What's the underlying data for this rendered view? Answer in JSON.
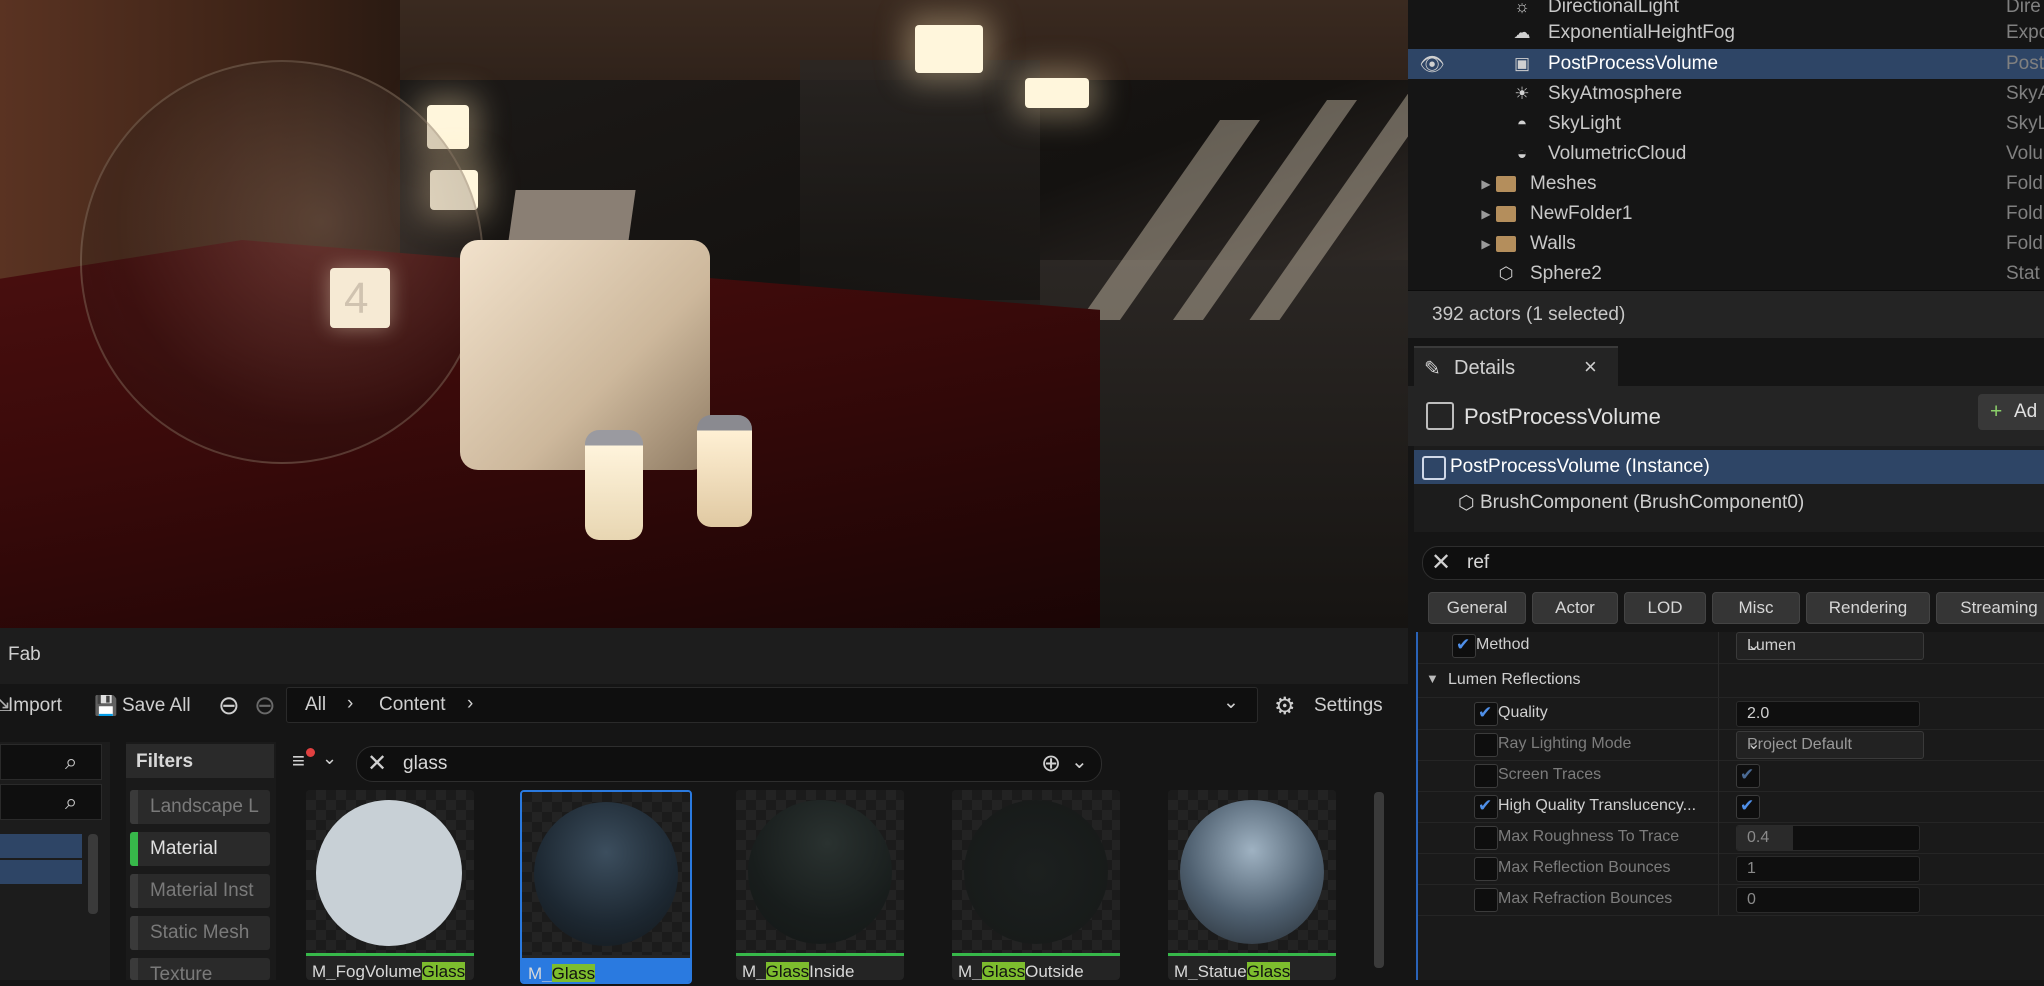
{
  "outliner": {
    "rows": [
      {
        "name": "DirectionalLight",
        "type": "Dire",
        "icon": "sun-icon"
      },
      {
        "name": "ExponentialHeightFog",
        "type": "Expo",
        "icon": "fog-icon"
      },
      {
        "name": "PostProcessVolume",
        "type": "Post",
        "icon": "postprocess-icon",
        "selected": true
      },
      {
        "name": "SkyAtmosphere",
        "type": "SkyA",
        "icon": "sky-atmosphere-icon"
      },
      {
        "name": "SkyLight",
        "type": "SkyL",
        "icon": "skylight-icon"
      },
      {
        "name": "VolumetricCloud",
        "type": "Volu",
        "icon": "cloud-icon"
      },
      {
        "name": "Meshes",
        "type": "Fold",
        "icon": "folder-icon"
      },
      {
        "name": "NewFolder1",
        "type": "Fold",
        "icon": "folder-icon"
      },
      {
        "name": "Walls",
        "type": "Fold",
        "icon": "folder-icon"
      },
      {
        "name": "Sphere2",
        "type": "Stat",
        "icon": "static-mesh-icon"
      }
    ],
    "status": "392 actors (1 selected)"
  },
  "details": {
    "tab_label": "Details",
    "actor_name": "PostProcessVolume",
    "add_label": "Ad",
    "components": [
      "PostProcessVolume (Instance)",
      "BrushComponent (BrushComponent0)"
    ],
    "search_value": "ref",
    "filters": [
      "General",
      "Actor",
      "LOD",
      "Misc",
      "Rendering",
      "Streaming"
    ],
    "properties": {
      "method": {
        "label": "Method",
        "value": "Lumen"
      },
      "section": "Lumen Reflections",
      "quality": {
        "label": "Quality",
        "value": "2.0"
      },
      "ray_lighting_mode": {
        "label": "Ray Lighting Mode",
        "value": "Project Default"
      },
      "screen_traces": {
        "label": "Screen Traces"
      },
      "hq_translucency": {
        "label": "High Quality Translucency..."
      },
      "max_roughness": {
        "label": "Max Roughness To Trace",
        "value": "0.4"
      },
      "max_reflection_bounces": {
        "label": "Max Reflection Bounces",
        "value": "1"
      },
      "max_refraction_bounces": {
        "label": "Max Refraction Bounces",
        "value": "0"
      }
    }
  },
  "content_browser": {
    "tab_label": "Fab",
    "import_label": "Import",
    "save_all_label": "Save All",
    "path": [
      "All",
      "Content"
    ],
    "settings_label": "Settings",
    "filters_title": "Filters",
    "filter_items": [
      "Landscape L",
      "Material",
      "Material Inst",
      "Static Mesh",
      "Texture"
    ],
    "search_value": "glass",
    "assets": [
      {
        "prefix": "M_FogVolume",
        "match": "Glass",
        "suffix": ""
      },
      {
        "prefix": "M_",
        "match": "Glass",
        "suffix": ""
      },
      {
        "prefix": "M_",
        "match": "Glass",
        "suffix": "Inside"
      },
      {
        "prefix": "M_",
        "match": "Glass",
        "suffix": "Outside"
      },
      {
        "prefix": "M_Statue",
        "match": "Glass",
        "suffix": ""
      }
    ]
  },
  "viewport": {
    "table_number": "4"
  }
}
